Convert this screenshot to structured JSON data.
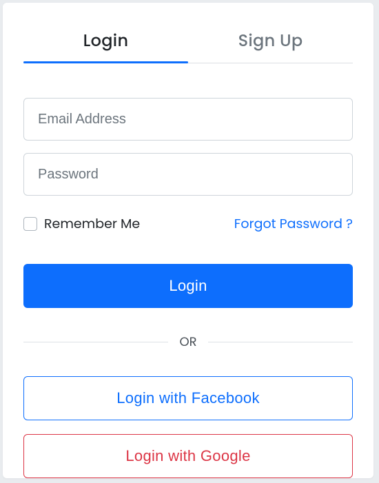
{
  "tabs": {
    "login": "Login",
    "signup": "Sign Up"
  },
  "form": {
    "email_placeholder": "Email Address",
    "password_placeholder": "Password",
    "remember_label": "Remember Me",
    "forgot_label": "Forgot Password ?",
    "login_button": "Login"
  },
  "divider": "OR",
  "social": {
    "facebook": "Login with Facebook",
    "google": "Login with Google"
  },
  "colors": {
    "primary": "#0d6efd",
    "danger": "#dc3545"
  }
}
